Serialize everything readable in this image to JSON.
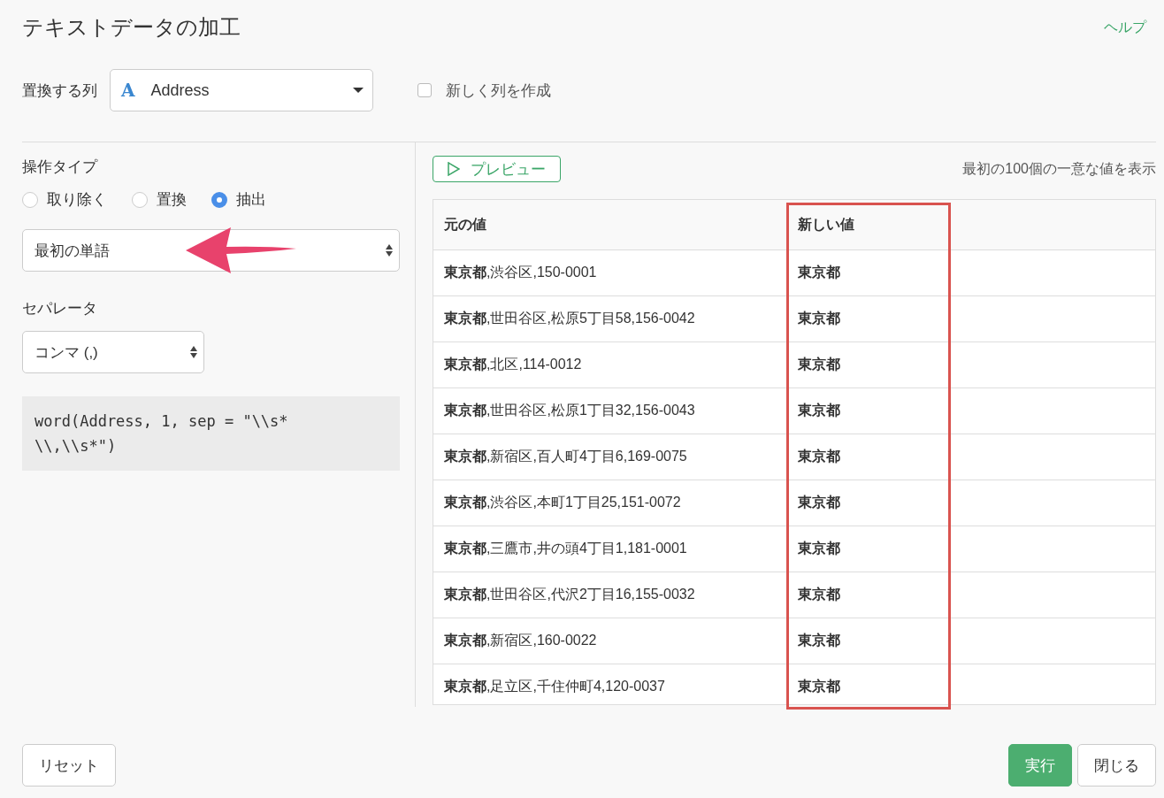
{
  "dialog": {
    "title": "テキストデータの加工",
    "help_link": "ヘルプ"
  },
  "column_select": {
    "label": "置換する列",
    "type_icon": "A",
    "value": "Address"
  },
  "new_column_checkbox": {
    "label": "新しく列を作成",
    "checked": false
  },
  "operation": {
    "label": "操作タイプ",
    "options": [
      {
        "label": "取り除く",
        "selected": false
      },
      {
        "label": "置換",
        "selected": false
      },
      {
        "label": "抽出",
        "selected": true
      }
    ],
    "mode_select": {
      "value": "最初の単語"
    }
  },
  "separator": {
    "label": "セパレータ",
    "value": "コンマ (,)"
  },
  "code_preview": "word(Address, 1, sep = \"\\\\s*\\\\,\\\\s*\")",
  "preview": {
    "button": "プレビュー",
    "note": "最初の100個の一意な値を表示"
  },
  "table": {
    "columns": [
      "元の値",
      "新しい値"
    ],
    "rows": [
      [
        "**東京都**,渋谷区,150-0001",
        "東京都"
      ],
      [
        "**東京都**,世田谷区,松原5丁目58,156-0042",
        "東京都"
      ],
      [
        "**東京都**,北区,114-0012",
        "東京都"
      ],
      [
        "**東京都**,世田谷区,松原1丁目32,156-0043",
        "東京都"
      ],
      [
        "**東京都**,新宿区,百人町4丁目6,169-0075",
        "東京都"
      ],
      [
        "**東京都**,渋谷区,本町1丁目25,151-0072",
        "東京都"
      ],
      [
        "**東京都**,三鷹市,井の頭4丁目1,181-0001",
        "東京都"
      ],
      [
        "**東京都**,世田谷区,代沢2丁目16,155-0032",
        "東京都"
      ],
      [
        "**東京都**,新宿区,160-0022",
        "東京都"
      ],
      [
        "**東京都**,足立区,千住仲町4,120-0037",
        "東京都"
      ]
    ]
  },
  "footer": {
    "reset": "リセット",
    "run": "実行",
    "close": "閉じる"
  }
}
